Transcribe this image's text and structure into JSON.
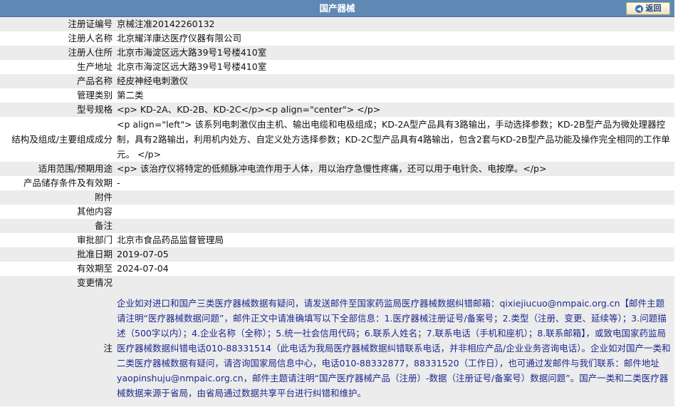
{
  "header": {
    "title": "国产器械",
    "back_label": "返回"
  },
  "rows": [
    {
      "label": "注册证编号",
      "value": "京械注准20142260132"
    },
    {
      "label": "注册人名称",
      "value": "北京耀洋康达医疗仪器有限公司"
    },
    {
      "label": "注册人住所",
      "value": "北京市海淀区远大路39号1号楼410室"
    },
    {
      "label": "生产地址",
      "value": "北京市海淀区远大路39号1号楼410室"
    },
    {
      "label": "产品名称",
      "value": "经皮神经电刺激仪"
    },
    {
      "label": "管理类别",
      "value": "第二类"
    },
    {
      "label": "型号规格",
      "value": "<p> KD-2A、KD-2B、KD-2C</p><p align=\"center\"> </p>"
    },
    {
      "label": "结构及组成/主要组成成分",
      "value": "<p align=\"left\"> 该系列电刺激仪由主机、输出电缆和电极组成；KD-2A型产品具有3路输出，手动选择参数；KD-2B型产品为微处理器控制，具有2路输出，利用机内处方、自定义处方选择参数；KD-2C型产品具有4路输出，包含2套与KD-2B型产品功能及操作完全相同的工作单元。 </p>"
    },
    {
      "label": "适用范围/预期用途",
      "value": "<p> 该治疗仪将特定的低频脉冲电流作用于人体，用以治疗急慢性疼痛，还可以用于电针灸、电按摩。</p>"
    },
    {
      "label": "产品储存条件及有效期",
      "value": "-"
    },
    {
      "label": "附件",
      "value": ""
    },
    {
      "label": "其他内容",
      "value": ""
    },
    {
      "label": "备注",
      "value": ""
    },
    {
      "label": "审批部门",
      "value": "北京市食品药品监督管理局"
    },
    {
      "label": "批准日期",
      "value": "2019-07-05"
    },
    {
      "label": "有效期至",
      "value": "2024-07-04"
    },
    {
      "label": "变更情况",
      "value": ""
    },
    {
      "label": "注",
      "value": "企业如对进口和国产三类医疗器械数据有疑问，请发送邮件至国家药监局医疗器械数据纠错邮箱：qixiejiucuo@nmpaic.org.cn【邮件主题请注明“医疗器械数据问题”，邮件正文中请准确填写以下全部信息：1.医疗器械注册证号/备案号；2.类型（注册、变更、延续等）；3.问题描述（500字以内）；4.企业名称（全称）；5.统一社会信用代码；6.联系人姓名；7.联系电话（手机和座机）；8.联系邮箱】，或致电国家药监局医疗器械数据纠错电话010-88331514（此电话为我局医疗器械数据纠错联系电话，并非相应产品/企业业务咨询电话）。企业如对国产一类和二类医疗器械数据有疑问，请咨询国家局信息中心，电话010-88332877，88331520（工作日），也可通过发邮件与我们联系：邮件地址yaopinshuju@nmpaic.org.cn，邮件主题请注明“国产医疗器械产品（注册）-数据（注册证号/备案号）数据问题”。国产一类和二类医疗器械数据来源于省局，由省局通过数据共享平台进行纠错和维护。"
    }
  ]
}
